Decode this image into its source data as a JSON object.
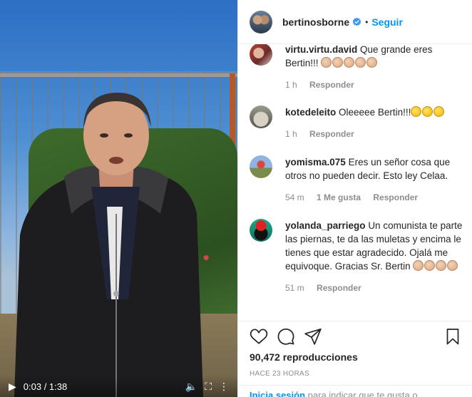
{
  "video": {
    "time": "0:03 / 1:38",
    "play_icon": "play-icon",
    "volume_icon": "volume-icon",
    "fullscreen_icon": "fullscreen-icon",
    "more_icon": "more-vertical-icon"
  },
  "header": {
    "username": "bertinosborne",
    "verified_icon": "verified-badge-icon",
    "separator": "•",
    "follow_label": "Seguir",
    "accent": "#0095f6"
  },
  "comments": [
    {
      "user": "virtu.virtu.david",
      "text": "Que grande eres Bertin!!!",
      "emoji": [
        "clap",
        "clap",
        "clap",
        "clap",
        "clap"
      ],
      "time": "1 h",
      "likes": "",
      "reply": "Responder"
    },
    {
      "user": "kotedeleito",
      "text": "Oleeeee Bertin!!!",
      "emoji": [
        "wave",
        "wave",
        "wave"
      ],
      "time": "1 h",
      "likes": "",
      "reply": "Responder"
    },
    {
      "user": "yomisma.075",
      "text": "Eres un señor cosa que otros no pueden decir. Esto ley Celaa.",
      "emoji": [],
      "time": "54 m",
      "likes": "1 Me gusta",
      "reply": "Responder"
    },
    {
      "user": "yolanda_parriego",
      "text": "Un comunista te parte las piernas, te da las muletas y encima le tienes que estar agradecido. Ojalá me equivoque. Gracias Sr. Bertin",
      "emoji": [
        "clap",
        "clap",
        "clap",
        "clap"
      ],
      "time": "51 m",
      "likes": "",
      "reply": "Responder"
    }
  ],
  "actions": {
    "like_icon": "heart-icon",
    "comment_icon": "comment-icon",
    "share_icon": "share-icon",
    "save_icon": "bookmark-icon",
    "views": "90,472 reproducciones",
    "ago": "HACE 23 HORAS"
  },
  "footer": {
    "login_link": "Inicia sesión",
    "login_text": " para indicar que te gusta o"
  }
}
